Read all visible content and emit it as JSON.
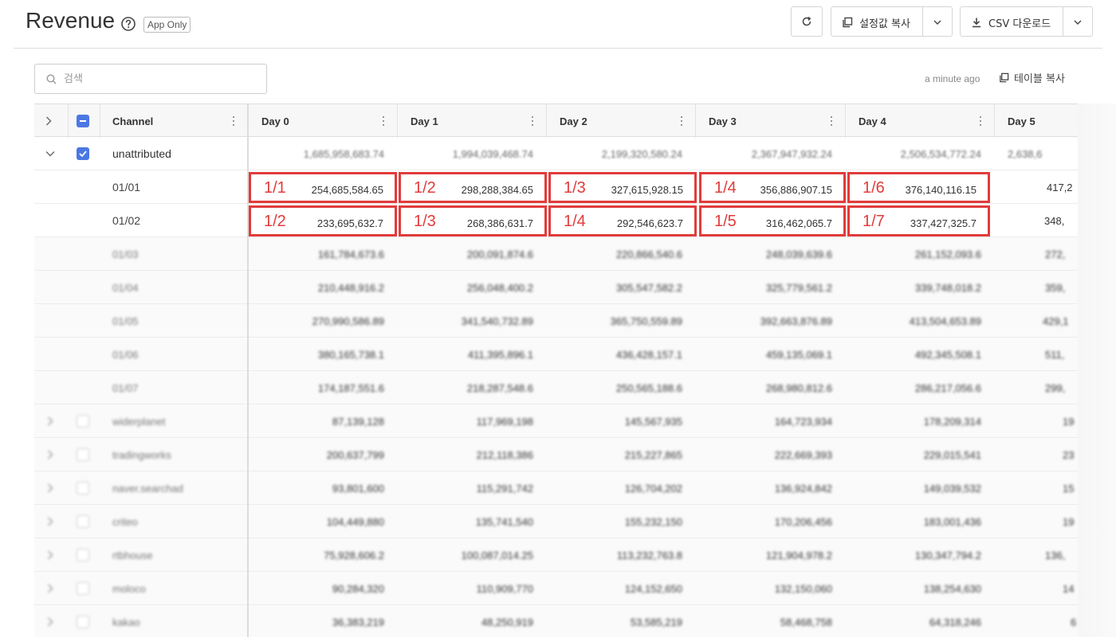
{
  "header": {
    "title": "Revenue",
    "badge": "App Only",
    "copy_settings_label": "설정값 복사",
    "csv_label": "CSV 다운로드"
  },
  "search": {
    "placeholder": "검색"
  },
  "toolbar": {
    "updated": "a minute ago",
    "table_copy_label": "테이블 복사"
  },
  "table": {
    "columns": [
      "Channel",
      "Day 0",
      "Day 1",
      "Day 2",
      "Day 3",
      "Day 4",
      "Day 5"
    ],
    "group": {
      "name": "unattributed",
      "totals": [
        "1,685,958,683.74",
        "1,994,039,468.74",
        "2,199,320,580.24",
        "2,367,947,932.24",
        "2,506,534,772.24",
        "2,638,6"
      ]
    },
    "highlighted_rows": [
      {
        "label": "01/01",
        "cells": [
          {
            "tag": "1/1",
            "value": "254,685,584.65"
          },
          {
            "tag": "1/2",
            "value": "298,288,384.65"
          },
          {
            "tag": "1/3",
            "value": "327,615,928.15"
          },
          {
            "tag": "1/4",
            "value": "356,886,907.15"
          },
          {
            "tag": "1/6",
            "value": "376,140,116.15"
          }
        ],
        "day5": "417,2"
      },
      {
        "label": "01/02",
        "cells": [
          {
            "tag": "1/2",
            "value": "233,695,632.7"
          },
          {
            "tag": "1/3",
            "value": "268,386,631.7"
          },
          {
            "tag": "1/4",
            "value": "292,546,623.7"
          },
          {
            "tag": "1/5",
            "value": "316,462,065.7"
          },
          {
            "tag": "1/7",
            "value": "337,427,325.7"
          }
        ],
        "day5": "348,"
      }
    ],
    "date_rows": [
      {
        "label": "01/03",
        "values": [
          "161,784,673.6",
          "200,091,874.6",
          "220,866,540.6",
          "248,039,639.6",
          "261,152,093.6",
          "272,"
        ]
      },
      {
        "label": "01/04",
        "values": [
          "210,448,916.2",
          "256,048,400.2",
          "305,547,582.2",
          "325,779,561.2",
          "339,748,018.2",
          "359,"
        ]
      },
      {
        "label": "01/05",
        "values": [
          "270,990,586.89",
          "341,540,732.89",
          "365,750,559.89",
          "392,663,876.89",
          "413,504,653.89",
          "429,1"
        ]
      },
      {
        "label": "01/06",
        "values": [
          "380,165,738.1",
          "411,395,896.1",
          "436,428,157.1",
          "459,135,069.1",
          "492,345,508.1",
          "511,"
        ]
      },
      {
        "label": "01/07",
        "values": [
          "174,187,551.6",
          "218,287,548.6",
          "250,565,188.6",
          "268,980,812.6",
          "286,217,056.6",
          "299,"
        ]
      }
    ],
    "channel_rows": [
      {
        "label": "widerplanet",
        "values": [
          "87,139,128",
          "117,969,198",
          "145,567,935",
          "164,723,934",
          "178,209,314",
          "19"
        ]
      },
      {
        "label": "tradingworks",
        "values": [
          "200,637,799",
          "212,118,386",
          "215,227,865",
          "222,669,393",
          "229,015,541",
          "23"
        ]
      },
      {
        "label": "naver.searchad",
        "values": [
          "93,801,600",
          "115,291,742",
          "126,704,202",
          "136,924,842",
          "149,039,532",
          "15"
        ]
      },
      {
        "label": "criteo",
        "values": [
          "104,449,880",
          "135,741,540",
          "155,232,150",
          "170,206,456",
          "183,001,436",
          "19"
        ]
      },
      {
        "label": "rtbhouse",
        "values": [
          "75,928,606.2",
          "100,087,014.25",
          "113,232,763.8",
          "121,904,978.2",
          "130,347,794.2",
          "136,"
        ]
      },
      {
        "label": "moloco",
        "values": [
          "90,284,320",
          "110,909,770",
          "124,152,650",
          "132,150,060",
          "138,254,630",
          "14"
        ]
      },
      {
        "label": "kakao",
        "values": [
          "36,383,219",
          "48,250,919",
          "53,585,219",
          "58,468,758",
          "64,318,246",
          "6"
        ]
      }
    ]
  },
  "colors": {
    "accent": "#4b77e4",
    "highlight": "#e23b3b"
  }
}
